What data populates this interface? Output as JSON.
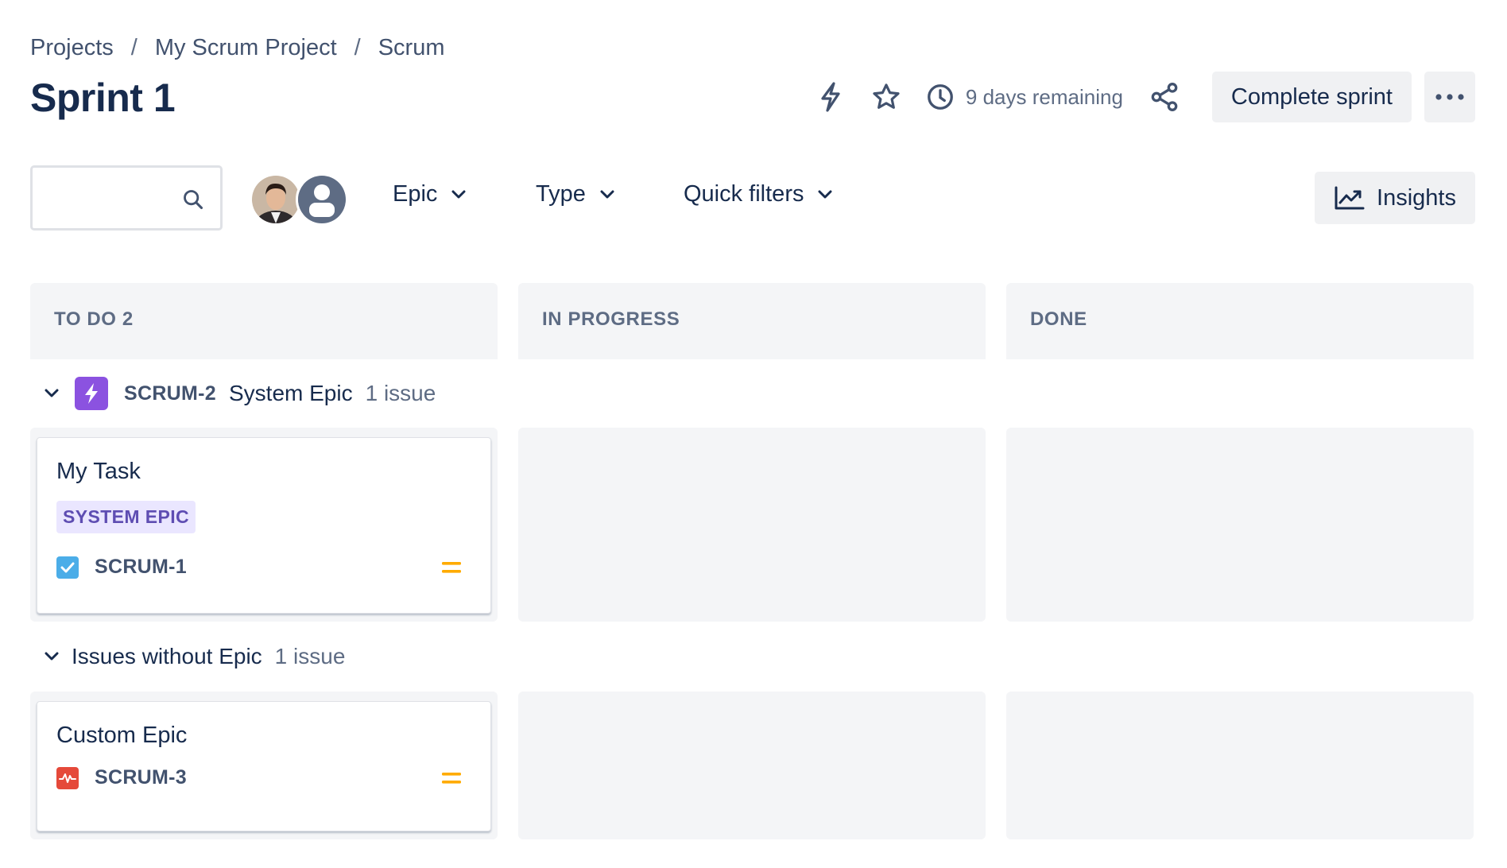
{
  "breadcrumb": {
    "items": [
      "Projects",
      "My Scrum Project",
      "Scrum"
    ],
    "separator": "/"
  },
  "page_title": "Sprint 1",
  "header": {
    "remaining_text": "9 days remaining",
    "complete_label": "Complete sprint",
    "icons": [
      "lightning-icon",
      "star-icon",
      "clock-icon",
      "share-icon",
      "more-icon"
    ]
  },
  "toolbar": {
    "search_value": "",
    "filters": [
      {
        "label": "Epic"
      },
      {
        "label": "Type"
      },
      {
        "label": "Quick filters"
      }
    ],
    "insights_label": "Insights"
  },
  "columns": [
    {
      "label": "TO DO 2"
    },
    {
      "label": "IN PROGRESS"
    },
    {
      "label": "DONE"
    }
  ],
  "swimlanes": [
    {
      "key": "SCRUM-2",
      "name": "System Epic",
      "count": "1 issue",
      "card": {
        "title": "My Task",
        "epic_label": "SYSTEM EPIC",
        "issue_key": "SCRUM-1",
        "type": "task",
        "priority": "medium"
      }
    },
    {
      "name": "Issues without Epic",
      "count": "1 issue",
      "card": {
        "title": "Custom Epic",
        "issue_key": "SCRUM-3",
        "type": "custom",
        "priority": "medium"
      }
    }
  ],
  "colors": {
    "text": "#172b4d",
    "subtle": "#5e6c84",
    "epic_purple": "#8b52e0",
    "task_blue": "#4bade8",
    "custom_red": "#e5493a",
    "priority_orange": "#ffab00",
    "column_bg": "#f4f5f7"
  }
}
